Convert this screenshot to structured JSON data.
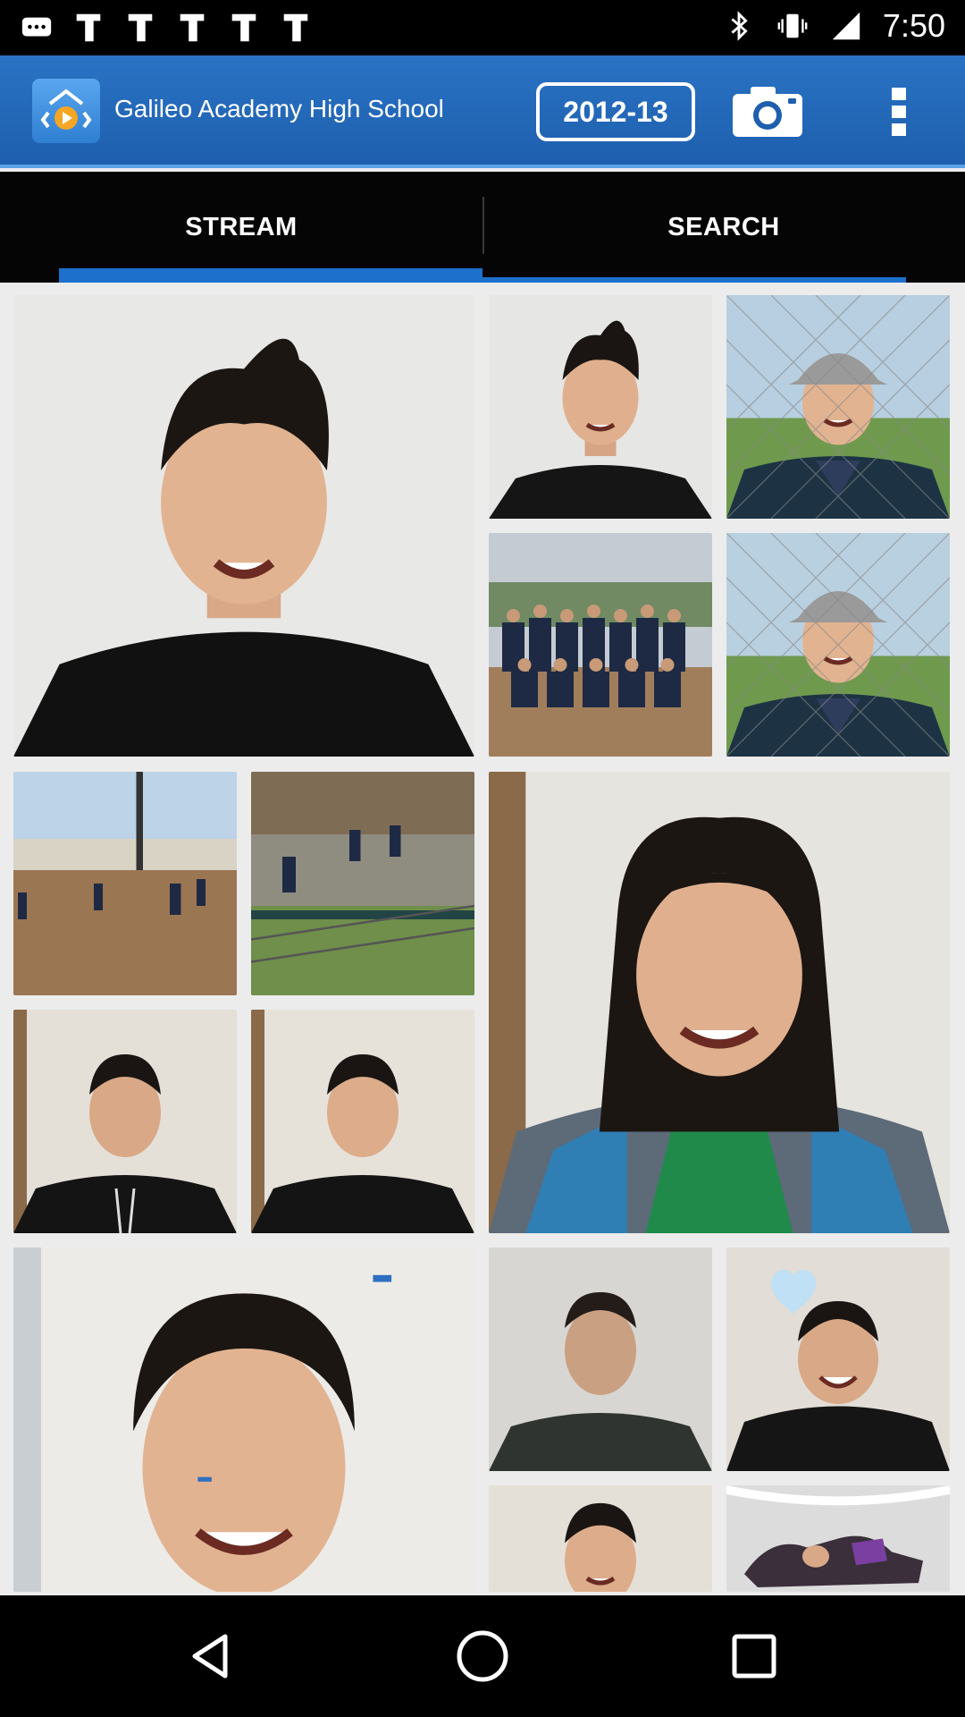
{
  "status_bar": {
    "time": "7:50",
    "left_icons": [
      "message-icon",
      "notification-icon",
      "notification-icon",
      "notification-icon",
      "notification-icon",
      "notification-icon"
    ],
    "right_icons": [
      "bluetooth-icon",
      "vibrate-icon",
      "signal-icon"
    ]
  },
  "header": {
    "title": "Galileo Academy High School",
    "year": "2012-13"
  },
  "tabs": [
    {
      "label": "STREAM",
      "selected": true
    },
    {
      "label": "SEARCH",
      "selected": false
    }
  ],
  "photos": [
    {
      "subject": "portrait-smiling-boy-spiky-hair"
    },
    {
      "subject": "portrait-smiling-boy-spiky-hair"
    },
    {
      "subject": "boy-cap-chain-fence"
    },
    {
      "subject": "baseball-team-group"
    },
    {
      "subject": "boy-cap-chain-fence"
    },
    {
      "subject": "baseball-field-players"
    },
    {
      "subject": "baseball-practice-bleachers"
    },
    {
      "subject": "portrait-smiling-girl-long-hair"
    },
    {
      "subject": "portrait-boy-black-hoodie"
    },
    {
      "subject": "portrait-boy-black-shirt"
    },
    {
      "subject": "portrait-smiling-boy-closeup"
    },
    {
      "subject": "portrait-young-man-dark-shirt"
    },
    {
      "subject": "portrait-smiling-boy-hoodie-heart"
    },
    {
      "subject": "portrait-smiling-boy-partial"
    },
    {
      "subject": "wrestling-match"
    }
  ],
  "colors": {
    "action_bar": "#1e5fae",
    "tab_indicator": "#1d70cc",
    "tab_bar": "#050505"
  }
}
